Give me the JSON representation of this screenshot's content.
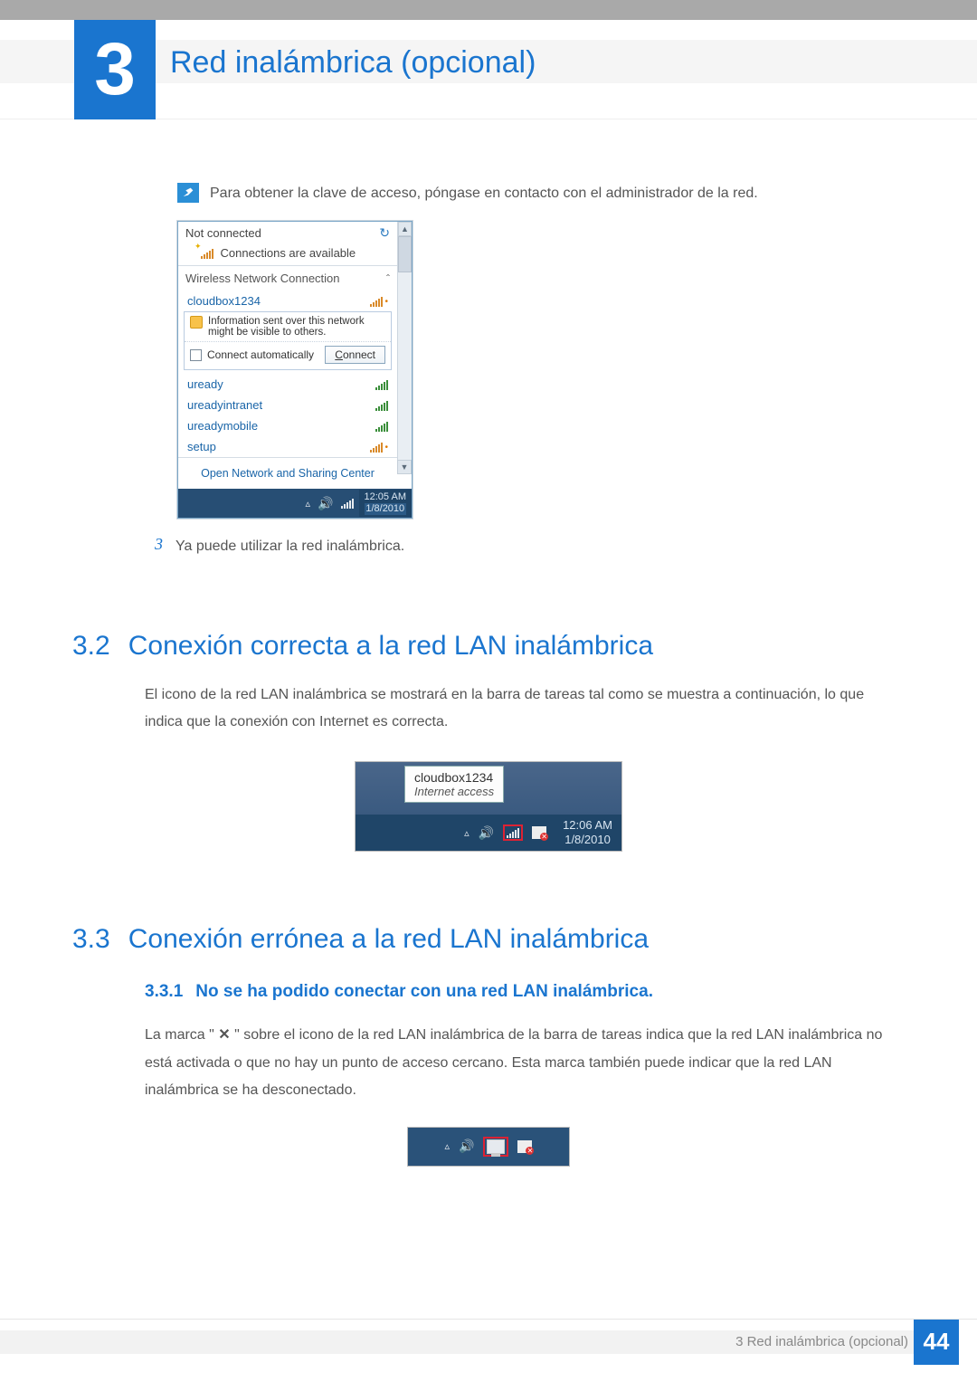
{
  "chapter": {
    "number": "3",
    "title": "Red inalámbrica (opcional)"
  },
  "note": {
    "text": "Para obtener la clave de acceso, póngase en contacto con el administrador de la red."
  },
  "wifi_popup": {
    "status": "Not connected",
    "available": "Connections are available",
    "category": "Wireless Network Connection",
    "selected_network": "cloudbox1234",
    "info_warning": "Information sent over this network might be visible to others.",
    "connect_auto_label": "Connect automatically",
    "connect_button_prefix": "C",
    "connect_button_rest": "onnect",
    "networks": [
      "uready",
      "ureadyintranet",
      "ureadymobile",
      "setup"
    ],
    "bottom_link": "Open Network and Sharing Center",
    "tray_time": "12:05 AM",
    "tray_date": "1/8/2010"
  },
  "step3": {
    "number": "3",
    "text": "Ya puede utilizar la red inalámbrica."
  },
  "section_3_2": {
    "number": "3.2",
    "title": "Conexión correcta a la red LAN inalámbrica",
    "body": "El icono de la red LAN inalámbrica se mostrará en la barra de tareas tal como se muestra a continuación, lo que indica que la conexión con Internet es correcta."
  },
  "taskbar_fig": {
    "tooltip_name": "cloudbox1234",
    "tooltip_status": "Internet access",
    "time": "12:06 AM",
    "date": "1/8/2010"
  },
  "section_3_3": {
    "number": "3.3",
    "title": "Conexión errónea a la red LAN inalámbrica"
  },
  "section_3_3_1": {
    "number": "3.3.1",
    "title": "No se ha podido conectar con una red LAN inalámbrica.",
    "body_pre": "La marca \" ",
    "body_mark": "✕",
    "body_post": " \" sobre el icono de la red LAN inalámbrica de la barra de tareas indica que la red LAN inalámbrica no está activada o que no hay un punto de acceso cercano. Esta marca también puede indicar que la red LAN inalámbrica se ha desconectado."
  },
  "footer": {
    "text": "3 Red inalámbrica (opcional)",
    "page": "44"
  }
}
